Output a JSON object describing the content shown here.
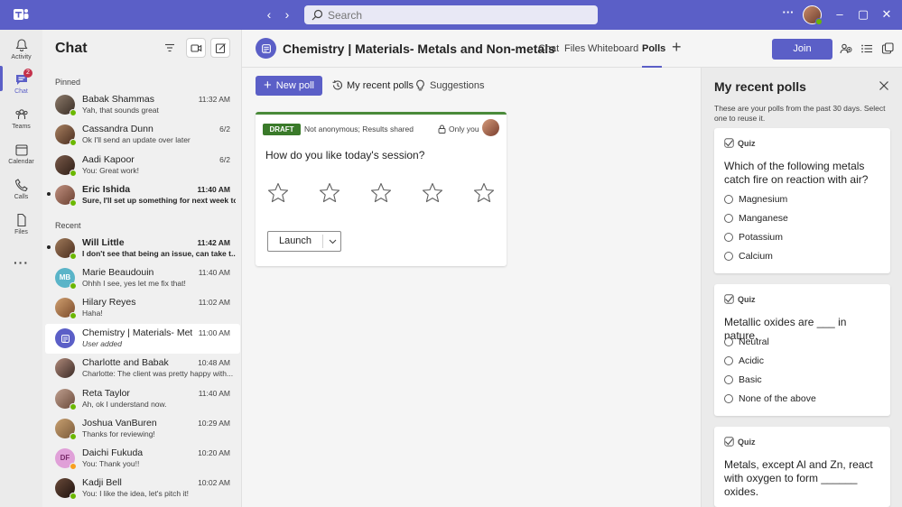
{
  "titlebar": {
    "search_placeholder": "Search",
    "more_label": "···"
  },
  "rail": {
    "items": [
      {
        "label": "Activity",
        "icon": "bell-icon"
      },
      {
        "label": "Chat",
        "icon": "chat-icon",
        "badge": "2"
      },
      {
        "label": "Teams",
        "icon": "teams-icon"
      },
      {
        "label": "Calendar",
        "icon": "calendar-icon"
      },
      {
        "label": "Calls",
        "icon": "phone-icon"
      },
      {
        "label": "Files",
        "icon": "file-icon"
      }
    ],
    "more": "···"
  },
  "chatlist": {
    "title": "Chat",
    "pinned_label": "Pinned",
    "recent_label": "Recent",
    "pinned": [
      {
        "name": "Babak Shammas",
        "time": "11:32 AM",
        "preview": "Yah, that sounds great"
      },
      {
        "name": "Cassandra Dunn",
        "time": "6/2",
        "preview": "Ok I'll send an update over later"
      },
      {
        "name": "Aadi Kapoor",
        "time": "6/2",
        "preview": "You: Great work!"
      },
      {
        "name": "Eric Ishida",
        "time": "11:40 AM",
        "preview": "Sure, I'll set up something for next week to..."
      }
    ],
    "recent": [
      {
        "name": "Will Little",
        "time": "11:42 AM",
        "preview": "I don't see that being an issue, can take t..."
      },
      {
        "name": "Marie Beaudouin",
        "time": "11:40 AM",
        "preview": "Ohhh I see, yes let me fix that!",
        "initials": "MB"
      },
      {
        "name": "Hilary Reyes",
        "time": "11:02 AM",
        "preview": "Haha!"
      },
      {
        "name": "Chemistry | Materials- Metals...",
        "time": "11:00 AM",
        "preview": "User added"
      },
      {
        "name": "Charlotte and Babak",
        "time": "10:48 AM",
        "preview": "Charlotte: The client was pretty happy with..."
      },
      {
        "name": "Reta Taylor",
        "time": "11:40 AM",
        "preview": "Ah, ok I understand now."
      },
      {
        "name": "Joshua VanBuren",
        "time": "10:29 AM",
        "preview": "Thanks for reviewing!"
      },
      {
        "name": "Daichi Fukuda",
        "time": "10:20 AM",
        "preview": "You: Thank you!!",
        "initials": "DF"
      },
      {
        "name": "Kadji Bell",
        "time": "10:02 AM",
        "preview": "You: I like the idea, let's pitch it!"
      }
    ]
  },
  "main": {
    "title": "Chemistry | Materials- Metals and Non-metals",
    "tabs": [
      "Chat",
      "Files",
      "Whiteboard",
      "Polls"
    ],
    "active_tab": "Polls",
    "join_label": "Join"
  },
  "polls": {
    "new_poll_label": "New poll",
    "my_recent_label": "My recent polls",
    "suggestions_label": "Suggestions",
    "card": {
      "badge": "DRAFT",
      "meta": "Not anonymous; Results shared",
      "visibility": "Only you",
      "question": "How do you like today's session?",
      "stars": 5,
      "launch_label": "Launch"
    }
  },
  "panel": {
    "title": "My recent polls",
    "description": "These are your polls from the past 30 days. Select one to reuse it.",
    "quizzes": [
      {
        "tag": "Quiz",
        "question": "Which of the following metals catch fire on reaction with air?",
        "options": [
          "Magnesium",
          "Manganese",
          "Potassium",
          "Calcium"
        ]
      },
      {
        "tag": "Quiz",
        "question": "Metallic oxides are ___ in nature.",
        "options": [
          "Neutral",
          "Acidic",
          "Basic",
          "None of the above"
        ]
      },
      {
        "tag": "Quiz",
        "question": "Metals, except Al and Zn, react with oxygen to form ______ oxides.",
        "options": []
      }
    ]
  },
  "colors": {
    "brand": "#5b5fc7",
    "presence": "#6bb700",
    "draft": "#3a7a2a"
  }
}
